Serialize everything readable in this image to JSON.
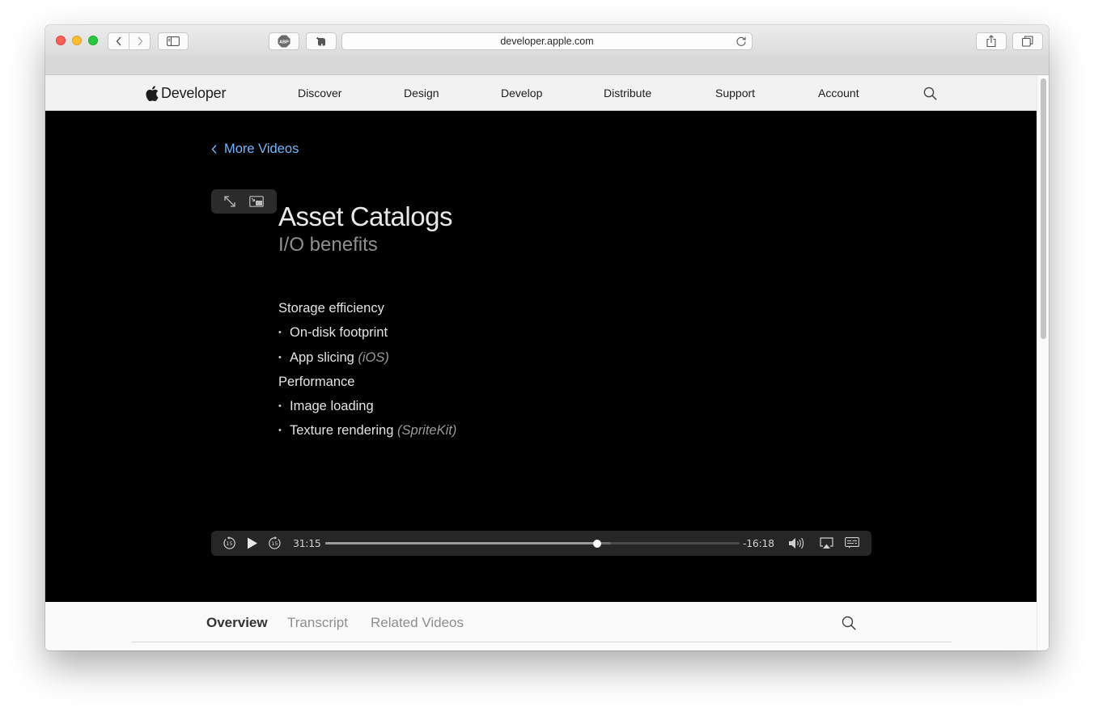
{
  "browser": {
    "url": "developer.apple.com",
    "abp_label": "ABP"
  },
  "devnav": {
    "logo_text": "Developer",
    "links": [
      "Discover",
      "Design",
      "Develop",
      "Distribute",
      "Support",
      "Account"
    ]
  },
  "video": {
    "back_link": "More Videos",
    "slide": {
      "title": "Asset Catalogs",
      "subtitle": "I/O benefits",
      "items": [
        {
          "text": "Storage efficiency",
          "note": "",
          "level": 0
        },
        {
          "text": "On-disk footprint",
          "note": "",
          "level": 1
        },
        {
          "text": "App slicing",
          "note": "(iOS)",
          "level": 1
        },
        {
          "text": "Performance",
          "note": "",
          "level": 0
        },
        {
          "text": "Image loading",
          "note": "",
          "level": 1
        },
        {
          "text": "Texture rendering",
          "note": "(SpriteKit)",
          "level": 1
        }
      ]
    },
    "player": {
      "elapsed": "31:15",
      "remaining": "-16:18",
      "progress_fraction": 0.656,
      "buffered_fraction": 0.69,
      "skip_back_label": "15",
      "skip_forward_label": "15"
    }
  },
  "bottom_tabs": {
    "items": [
      "Overview",
      "Transcript",
      "Related Videos"
    ],
    "active": "Overview"
  }
}
